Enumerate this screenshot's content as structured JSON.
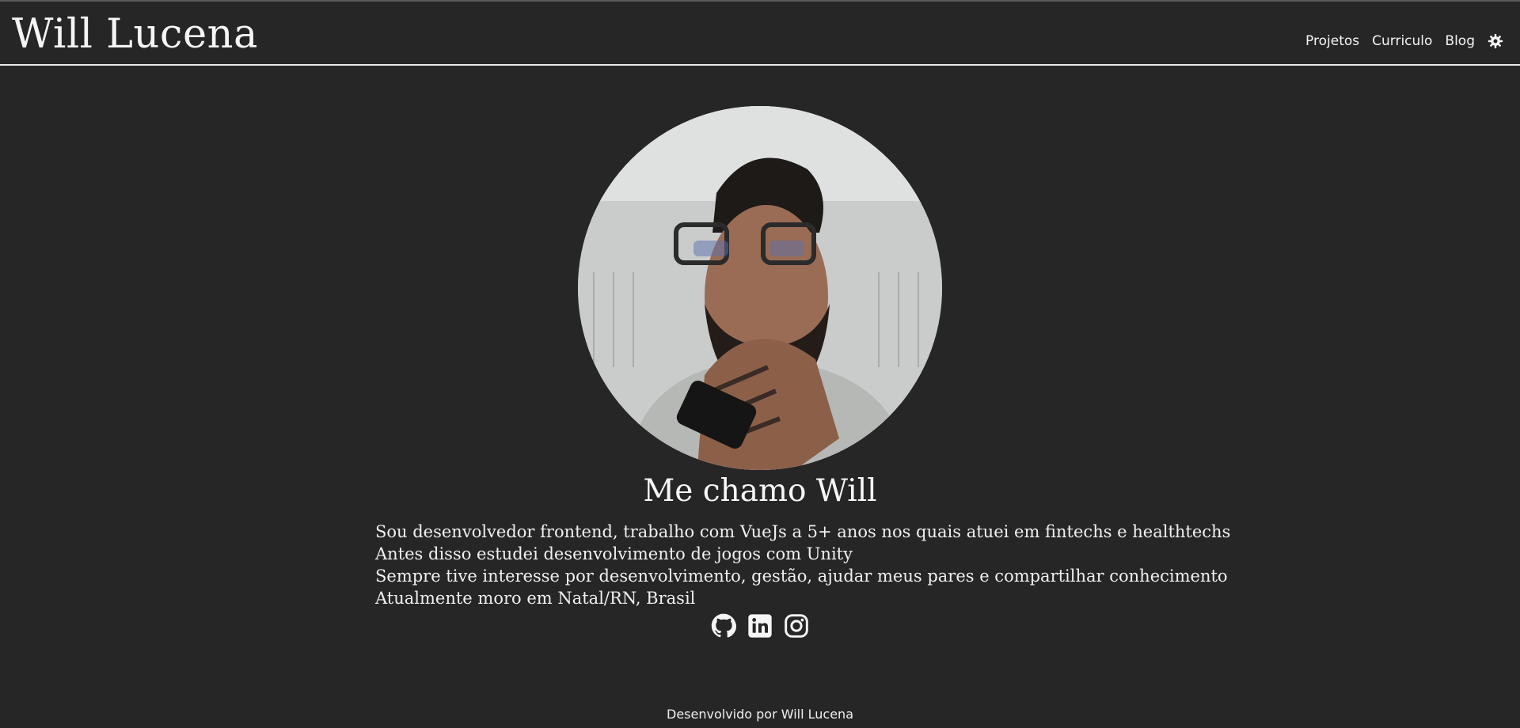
{
  "header": {
    "brand": "Will Lucena",
    "nav": [
      {
        "label": "Projetos"
      },
      {
        "label": "Curriculo"
      },
      {
        "label": "Blog"
      }
    ],
    "theme_toggle_icon": "gear-icon"
  },
  "profile": {
    "photo_icon": "profile-photo",
    "greeting": "Me chamo Will",
    "bio": [
      "Sou desenvolvedor frontend, trabalho com VueJs a 5+ anos nos quais atuei em fintechs e healthtechs",
      "Antes disso estudei desenvolvimento de jogos com Unity",
      "Sempre tive interesse por desenvolvimento, gestão, ajudar meus pares e compartilhar conhecimento",
      "Atualmente moro em Natal/RN, Brasil"
    ],
    "socials": [
      {
        "icon": "github-icon"
      },
      {
        "icon": "linkedin-icon"
      },
      {
        "icon": "instagram-icon"
      }
    ]
  },
  "footer": {
    "text": "Desenvolvido por Will Lucena"
  },
  "colors": {
    "background": "#262626",
    "text": "#f2f2f2",
    "divider": "#e9e9e9"
  }
}
